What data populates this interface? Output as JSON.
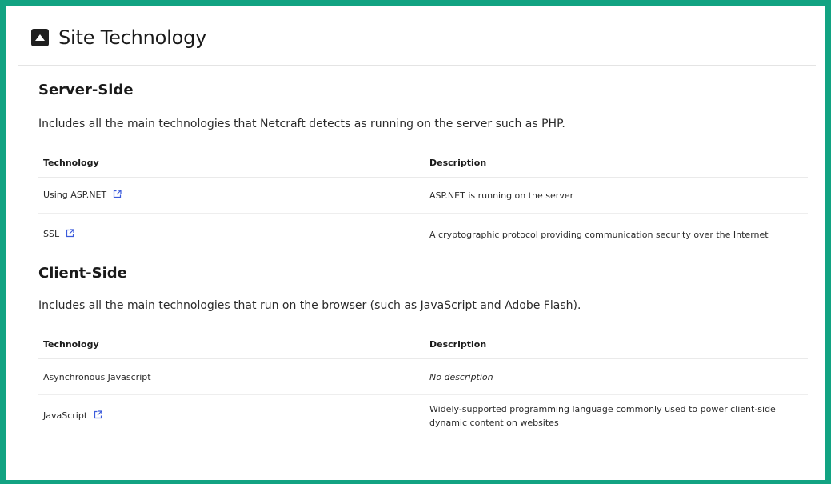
{
  "panel": {
    "title": "Site Technology",
    "toggle_icon": "caret-up-square-icon"
  },
  "server_side": {
    "title": "Server-Side",
    "description": "Includes all the main technologies that Netcraft detects as running on the server such as PHP.",
    "headers": {
      "technology": "Technology",
      "description": "Description"
    },
    "rows": [
      {
        "technology": "Using ASP.NET",
        "description": "ASP.NET is running on the server",
        "external_link": true
      },
      {
        "technology": "SSL",
        "description": "A cryptographic protocol providing communication security over the Internet",
        "external_link": true
      }
    ]
  },
  "client_side": {
    "title": "Client-Side",
    "description": "Includes all the main technologies that run on the browser (such as JavaScript and Adobe Flash).",
    "headers": {
      "technology": "Technology",
      "description": "Description"
    },
    "rows": [
      {
        "technology": "Asynchronous Javascript",
        "description": "No description",
        "external_link": false
      },
      {
        "technology": "JavaScript",
        "description": "Widely-supported programming language commonly used to power client-side dynamic content on websites",
        "external_link": true
      }
    ]
  },
  "colors": {
    "frame_border": "#12a382",
    "link_icon": "#3b5bdb"
  },
  "icons": {
    "external_link": "external-link-icon"
  }
}
